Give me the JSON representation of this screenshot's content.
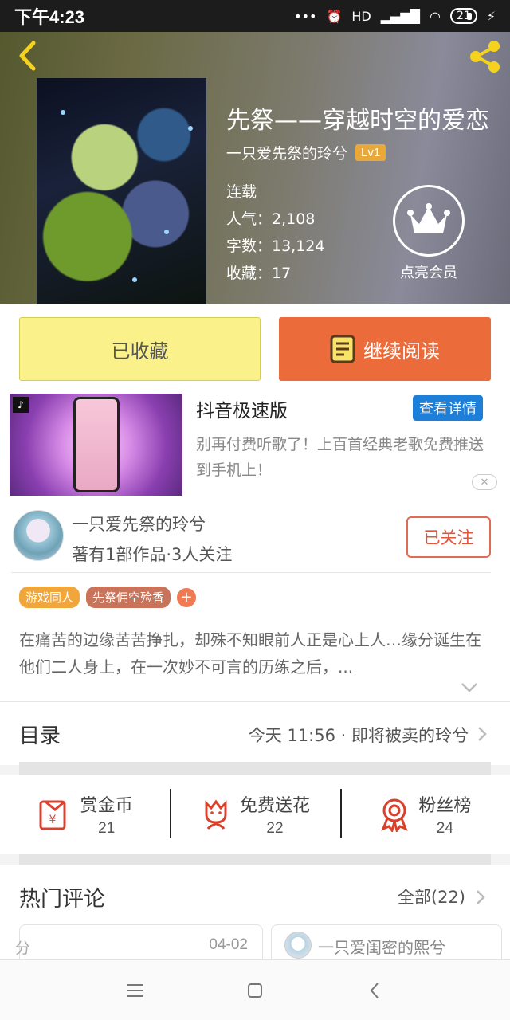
{
  "status_bar": {
    "time": "下午4:23",
    "signal": "HD",
    "battery": "21"
  },
  "book": {
    "title": "先祭——穿越时空的爱恋",
    "author": "一只爱先祭的玲兮",
    "level": "Lv1",
    "status": "连载",
    "popularity": "人气：2,108",
    "word_count": "字数：13,124",
    "favorites": "收藏：17",
    "vip_label": "点亮会员"
  },
  "actions": {
    "favorite_label": "已收藏",
    "read_label": "继续阅读"
  },
  "ad": {
    "title": "抖音极速版",
    "detail_label": "查看详情",
    "description": "别再付费听歌了！上百首经典老歌免费推送到手机上！"
  },
  "author_card": {
    "name": "一只爱先祭的玲兮",
    "stats": "著有1部作品·3人关注",
    "follow_label": "已关注",
    "tags": [
      {
        "label": "游戏同人",
        "color": "#f0a63a"
      },
      {
        "label": "先祭佣空殓香",
        "color": "#c9735a"
      }
    ],
    "tag_add": "+",
    "summary": "在痛苦的边缘苦苦挣扎，却殊不知眼前人正是心上人…缘分诞生在他们二人身上，在一次妙不可言的历练之后，..."
  },
  "catalog": {
    "title": "目录",
    "latest": "今天 11:56 · 即将被卖的玲兮"
  },
  "stats": [
    {
      "label": "赏金币",
      "value": "21",
      "icon": "red-envelope-icon"
    },
    {
      "label": "免费送花",
      "value": "22",
      "icon": "flower-icon"
    },
    {
      "label": "粉丝榜",
      "value": "24",
      "icon": "medal-icon"
    }
  ],
  "hot_comments": {
    "title": "热门评论",
    "all_label": "全部(22)",
    "cards": [
      {
        "fragment": "分",
        "date": "04-02"
      },
      {
        "name": "一只爱闺密的熙兮"
      }
    ]
  },
  "colors": {
    "accent_orange": "#ec6b3a",
    "favorite_yellow": "#faf18a",
    "icon_red": "#d9412c",
    "vip_badge": "#e9a93a"
  }
}
